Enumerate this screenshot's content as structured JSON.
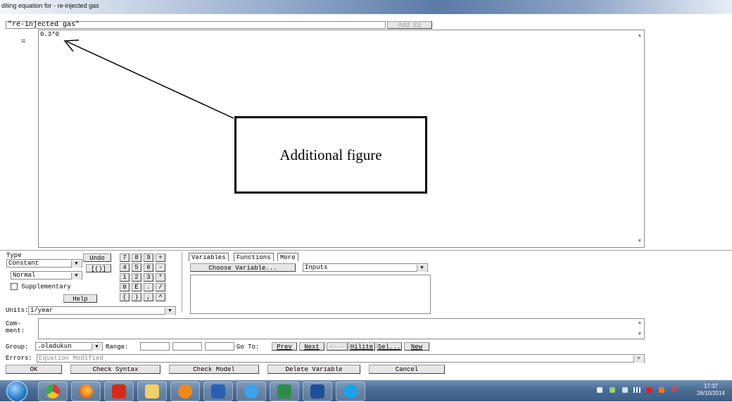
{
  "window": {
    "title": "diting equation for - re-injected gas"
  },
  "header": {
    "variable_name": "\"re-injected gas\"",
    "add_eq_label": "Add Eq"
  },
  "editor": {
    "equals": "=",
    "equation": "0.3*0"
  },
  "annotation": {
    "label": "Additional figure"
  },
  "type_panel": {
    "type_label": "Type",
    "type_value": "Constant",
    "mode_value": "Normal",
    "supplementary_label": "Supplementary",
    "help_label": "Help",
    "undo_label": "Undo",
    "brackets_label": "[()]"
  },
  "keypad": {
    "row1": [
      "7",
      "8",
      "9",
      "+"
    ],
    "row2": [
      "4",
      "5",
      "6",
      "-"
    ],
    "row3": [
      "1",
      "2",
      "3",
      "*"
    ],
    "row4": [
      "0",
      "E",
      ".",
      "/"
    ],
    "row5": [
      "(",
      ")",
      ",",
      "^"
    ]
  },
  "tabs": {
    "variables": "Variables",
    "functions": "Functions",
    "more": "More",
    "choose_variable": "Choose Variable...",
    "list_value": "Inputs"
  },
  "units": {
    "label": "Units:",
    "value": "1/year"
  },
  "comment": {
    "label_line1": "Com-",
    "label_line2": "ment:"
  },
  "group_row": {
    "group_label": "Group:",
    "group_value": ".oladukun",
    "range_label": "Range:",
    "goto_label": "Go To:",
    "prev_label": "Prev",
    "next_label": "Next",
    "back_label": "<---",
    "hilite_label": "Hilite",
    "sel_label": "Sel...",
    "new_label": "New"
  },
  "errors": {
    "label": "Errors:",
    "value": "Equation Modified"
  },
  "bottom_buttons": {
    "ok": "OK",
    "check_syntax": "Check Syntax",
    "check_model": "Check Model",
    "delete_variable": "Delete Variable",
    "cancel": "Cancel"
  },
  "taskbar": {
    "clock_time": "17:37",
    "clock_date": "26/10/2014",
    "apps": [
      "start-orb-icon",
      "chrome-icon",
      "firefox-icon",
      "acrobat-icon",
      "folder-icon",
      "media-player-icon",
      "word-icon",
      "internet-explorer-icon",
      "excel-icon",
      "vensim-icon",
      "skype-icon"
    ]
  }
}
